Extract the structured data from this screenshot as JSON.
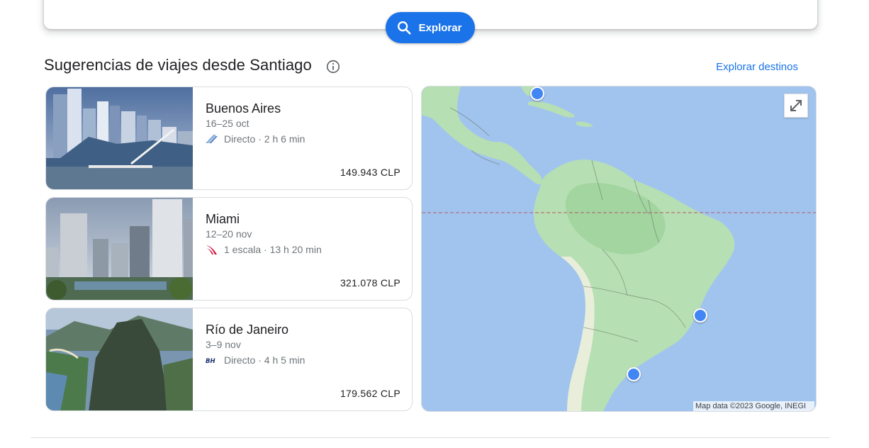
{
  "search": {
    "explore_label": "Explorar"
  },
  "section": {
    "title": "Sugerencias de viajes desde Santiago",
    "explore_destinations_label": "Explorar destinos"
  },
  "cards": [
    {
      "city": "Buenos Aires",
      "dates": "16–25 oct",
      "flight": "Directo · 2 h 6 min",
      "price": "149.943 CLP",
      "airline_icon": "aerolineas-argentinas-logo"
    },
    {
      "city": "Miami",
      "dates": "12–20 nov",
      "flight": "1 escala · 13 h 20 min",
      "price": "321.078 CLP",
      "airline_icon": "latam-logo"
    },
    {
      "city": "Río de Janeiro",
      "dates": "3–9 nov",
      "flight": "Directo · 4 h 5 min",
      "price": "179.562 CLP",
      "airline_icon": "sky-airline-logo"
    }
  ],
  "map": {
    "credit": "Map data ©2023 Google, INEGI"
  },
  "colors": {
    "accent": "#1a73e8",
    "pin": "#4285f4",
    "ocean": "#a1c4ef",
    "land": "#b6dfb3"
  }
}
